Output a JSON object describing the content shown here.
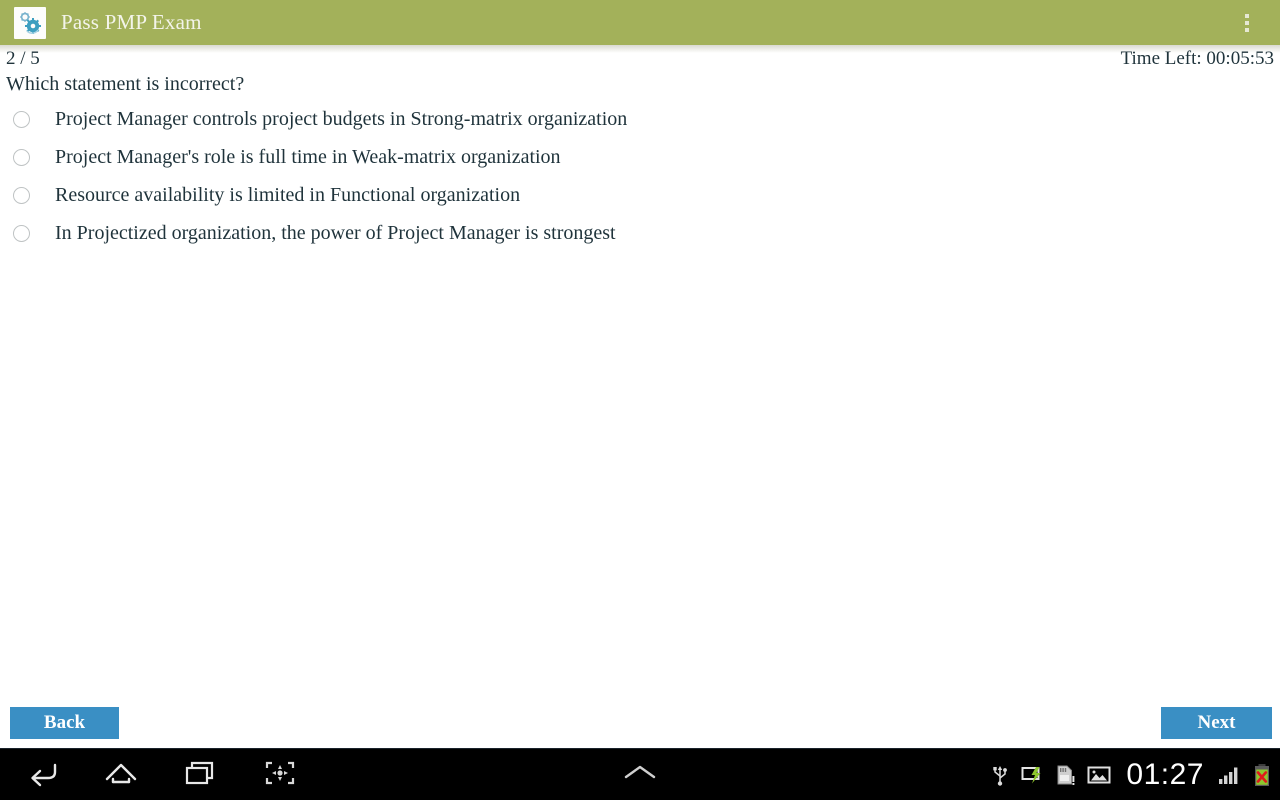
{
  "app": {
    "title": "Pass PMP Exam",
    "icon": "gears-icon",
    "header_color": "#a3b15a",
    "overflow_menu_label": "More options"
  },
  "quiz": {
    "progress": "2 / 5",
    "time_left": "Time Left: 00:05:53",
    "question": "Which statement is incorrect?",
    "options": [
      {
        "label": "Project Manager controls project budgets in Strong-matrix organization",
        "selected": false
      },
      {
        "label": "Project Manager's role is full time in Weak-matrix organization",
        "selected": false
      },
      {
        "label": "Resource availability is limited in Functional organization",
        "selected": false
      },
      {
        "label": "In Projectized organization, the power of Project Manager is strongest",
        "selected": false
      }
    ]
  },
  "nav": {
    "back_label": "Back",
    "next_label": "Next",
    "button_color": "#3a8fc4"
  },
  "system_bar": {
    "clock": "01:27",
    "buttons": [
      {
        "name": "back-icon"
      },
      {
        "name": "home-icon"
      },
      {
        "name": "recents-icon"
      },
      {
        "name": "screenshot-icon"
      },
      {
        "name": "chevron-up-icon"
      }
    ],
    "tray": [
      {
        "name": "usb-icon"
      },
      {
        "name": "usb-debugging-icon"
      },
      {
        "name": "sdcard-warning-icon"
      },
      {
        "name": "gallery-icon"
      },
      {
        "name": "signal-bars-icon"
      },
      {
        "name": "battery-error-icon"
      }
    ]
  }
}
